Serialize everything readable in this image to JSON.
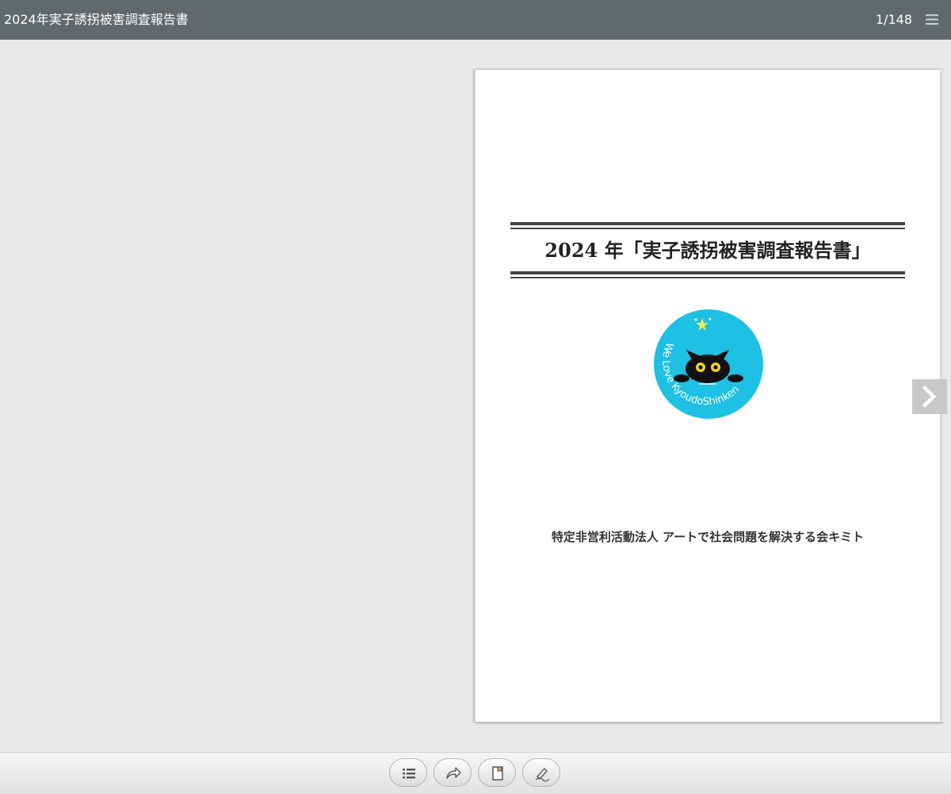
{
  "header": {
    "doc_title": "2024年実子誘拐被害調査報告書",
    "page_counter": "1/148",
    "menu_icon": "hamburger-menu-icon"
  },
  "page": {
    "title": "2024 年「実子誘拐被害調査報告書」",
    "logo_text": "We Love KyoudoShinken",
    "logo_colors": {
      "circle": "#1ec0e4",
      "cat": "#111111",
      "star": "#f5e94a"
    },
    "organization": "特定非営利活動法人 アートで社会問題を解決する会キミト"
  },
  "navigation": {
    "next_icon": "chevron-right-icon"
  },
  "toolbar": {
    "buttons": [
      {
        "icon": "list-icon"
      },
      {
        "icon": "share-arrow-icon"
      },
      {
        "icon": "bookmark-note-icon"
      },
      {
        "icon": "pen-icon"
      }
    ]
  },
  "colors": {
    "topbar": "#62696d",
    "viewer_background": "#e9e9e9",
    "next_button": "#c9c9c9"
  }
}
